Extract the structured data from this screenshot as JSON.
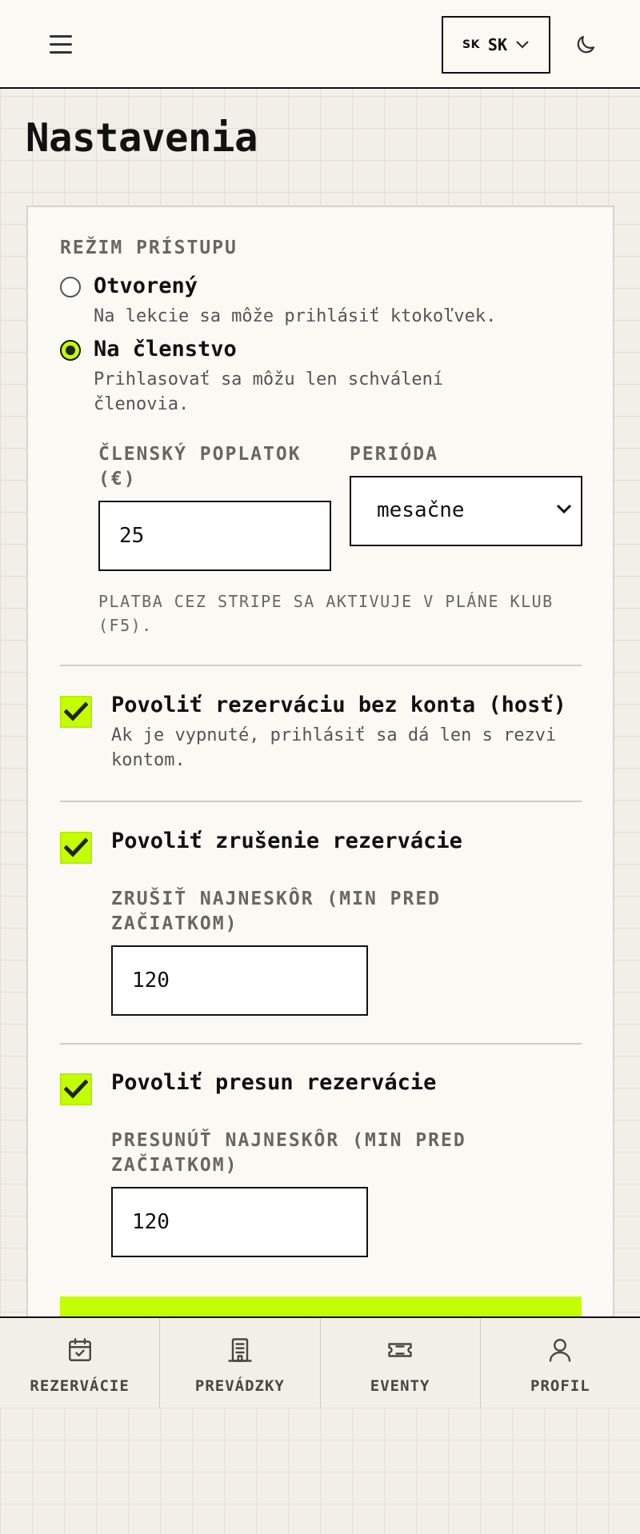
{
  "header": {
    "language_flag": "SK",
    "language_code": "SK"
  },
  "page": {
    "title": "Nastavenia"
  },
  "access_mode": {
    "label": "REŽIM PRÍSTUPU",
    "options": [
      {
        "title": "Otvorený",
        "description": "Na lekcie sa môže prihlásiť ktokoľvek.",
        "selected": false
      },
      {
        "title": "Na členstvo",
        "description": "Prihlasovať sa môžu len schválení členovia.",
        "selected": true
      }
    ],
    "fee_label": "ČLENSKÝ POPLATOK (€)",
    "fee_value": "25",
    "period_label": "PERIÓDA",
    "period_value": "mesačne",
    "stripe_hint": "PLATBA CEZ STRIPE SA AKTIVUJE V PLÁNE KLUB (F5)."
  },
  "guest_booking": {
    "title": "Povoliť rezerváciu bez konta (hosť)",
    "description": "Ak je vypnuté, prihlásiť sa dá len s rezvi kontom.",
    "checked": true
  },
  "cancellation": {
    "title": "Povoliť zrušenie rezervácie",
    "checked": true,
    "field_label": "ZRUŠIŤ NAJNESKÔR (MIN PRED ZAČIATKOM)",
    "field_value": "120"
  },
  "reschedule": {
    "title": "Povoliť presun rezervácie",
    "checked": true,
    "field_label": "PRESUNÚŤ NAJNESKÔR (MIN PRED ZAČIATKOM)",
    "field_value": "120"
  },
  "nav": {
    "items": [
      {
        "label": "REZERVÁCIE",
        "icon": "calendar-check-icon"
      },
      {
        "label": "PREVÁDZKY",
        "icon": "building-icon"
      },
      {
        "label": "EVENTY",
        "icon": "ticket-icon"
      },
      {
        "label": "PROFIL",
        "icon": "user-icon"
      }
    ]
  },
  "colors": {
    "accent": "#c4ff00",
    "text": "#111111",
    "muted": "#6b6660",
    "background": "#f2efe8",
    "surface": "#faf9f4"
  }
}
